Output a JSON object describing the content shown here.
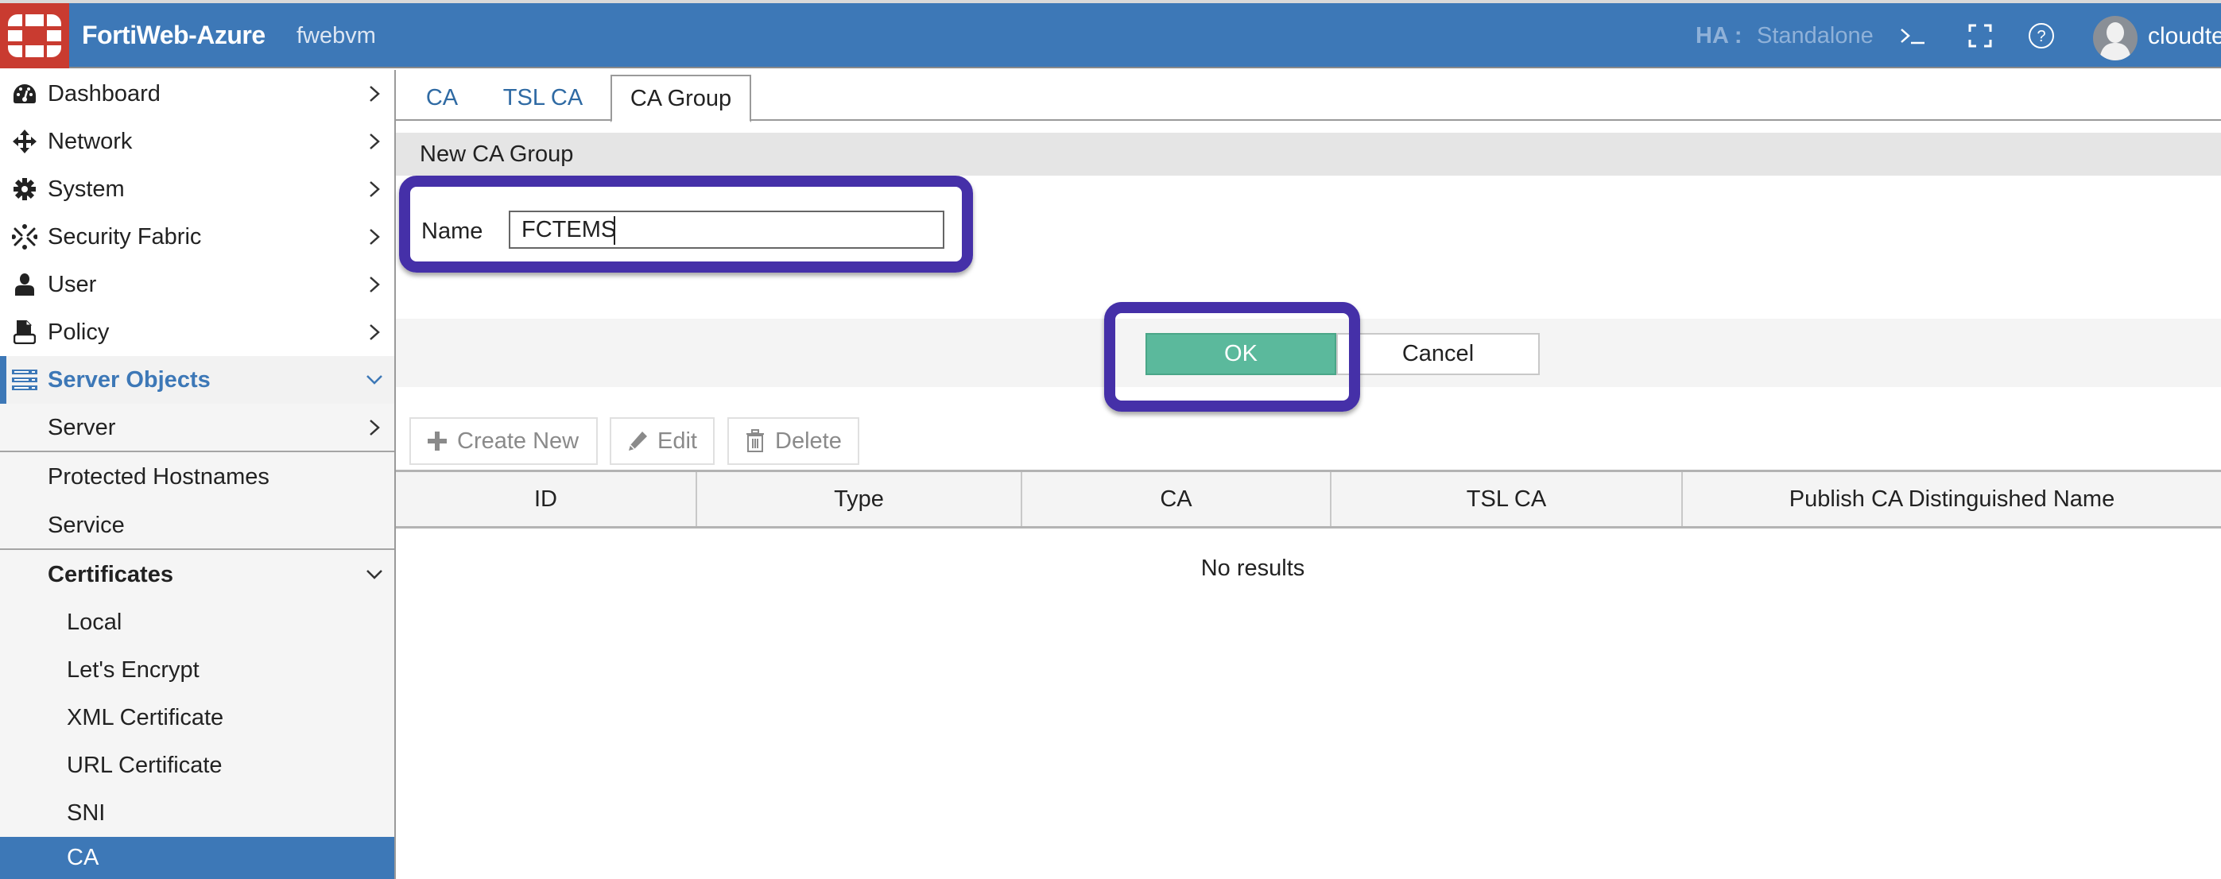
{
  "header": {
    "app_title": "FortiWeb-Azure",
    "hostname": "fwebvm",
    "ha_label": "HA :",
    "ha_value": "Standalone",
    "username": "cloudte",
    "icons": [
      "fortinet-logo-icon",
      "terminal-icon",
      "fullscreen-icon",
      "help-icon",
      "user-avatar-icon"
    ],
    "colors": {
      "header_bg": "#3d78b7",
      "logo_bg": "#c93b30"
    }
  },
  "sidebar": {
    "items": [
      {
        "label": "Dashboard",
        "icon": "dashboard-icon",
        "chevron": "right"
      },
      {
        "label": "Network",
        "icon": "network-arrows-icon",
        "chevron": "right"
      },
      {
        "label": "System",
        "icon": "gear-icon",
        "chevron": "right"
      },
      {
        "label": "Security Fabric",
        "icon": "security-fabric-icon",
        "chevron": "right"
      },
      {
        "label": "User",
        "icon": "user-icon",
        "chevron": "right"
      },
      {
        "label": "Policy",
        "icon": "policy-icon",
        "chevron": "right"
      },
      {
        "label": "Server Objects",
        "icon": "server-icon",
        "chevron": "down",
        "expanded": true
      }
    ],
    "server_objects_children": [
      {
        "label": "Server",
        "chevron": "right"
      },
      {
        "label": "Protected Hostnames"
      },
      {
        "label": "Service"
      },
      {
        "label": "Certificates",
        "chevron": "down",
        "expanded": true
      }
    ],
    "certificates_children": [
      {
        "label": "Local"
      },
      {
        "label": "Let's Encrypt"
      },
      {
        "label": "XML Certificate"
      },
      {
        "label": "URL Certificate"
      },
      {
        "label": "SNI"
      },
      {
        "label": "CA",
        "selected": true
      }
    ],
    "colors": {
      "accent": "#3d78b7"
    }
  },
  "main": {
    "tabs": [
      {
        "label": "CA",
        "active": false
      },
      {
        "label": "TSL CA",
        "active": false
      },
      {
        "label": "CA Group",
        "active": true
      }
    ],
    "section_title": "New CA Group",
    "form": {
      "name_label": "Name",
      "name_value": "FCTEMS"
    },
    "buttons": {
      "ok": "OK",
      "cancel": "Cancel",
      "ok_color": "#5bb99c"
    },
    "toolbar": {
      "create_new": "Create New",
      "edit": "Edit",
      "delete": "Delete"
    },
    "table": {
      "columns": [
        "ID",
        "Type",
        "CA",
        "TSL CA",
        "Publish CA Distinguished Name"
      ],
      "rows": [],
      "empty_text": "No results"
    },
    "annotation_color": "#4530a8"
  }
}
